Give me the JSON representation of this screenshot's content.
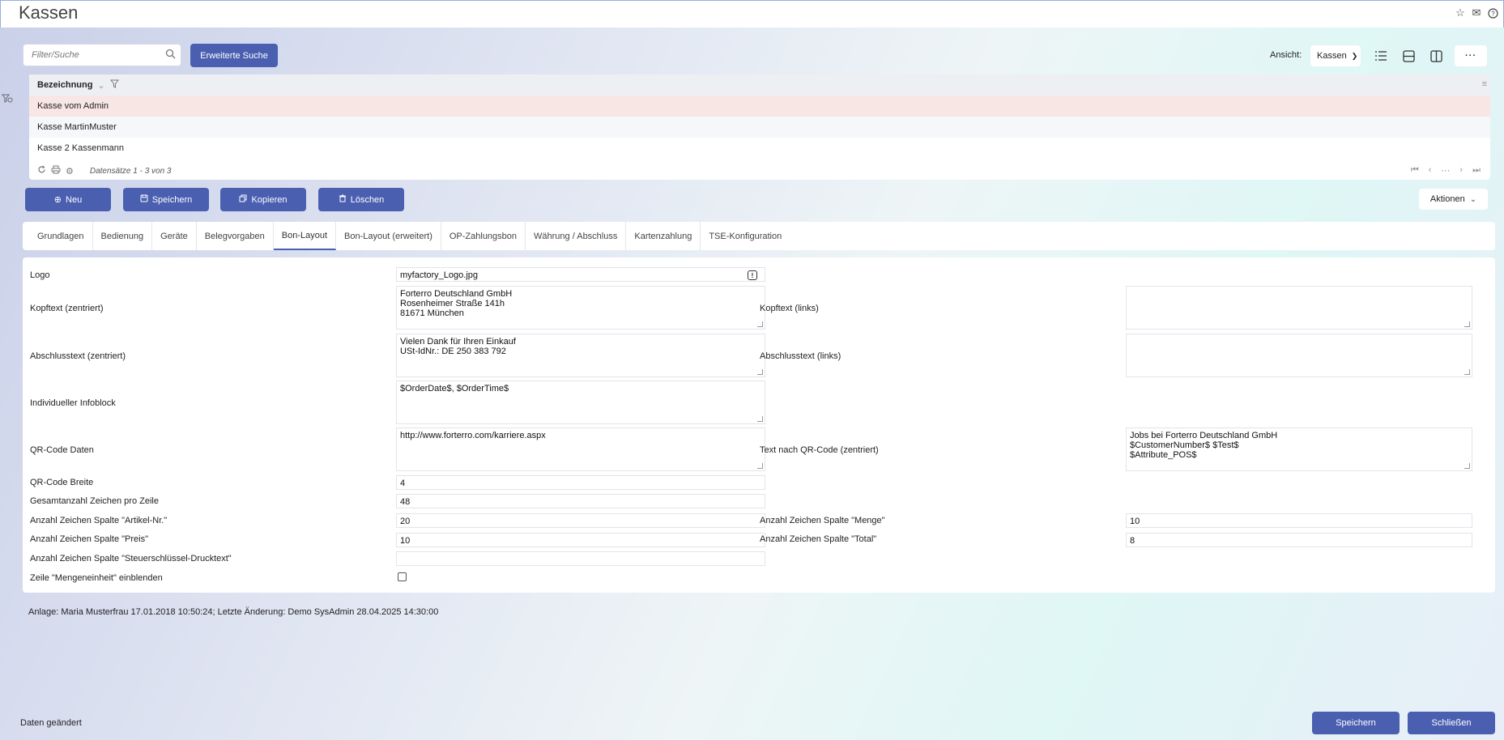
{
  "window": {
    "title": "Kassen"
  },
  "toolbar": {
    "search_placeholder": "Filter/Suche",
    "extended_search": "Erweiterte Suche",
    "view_label": "Ansicht:",
    "view_value": "Kassen",
    "more": "···"
  },
  "grid": {
    "column": "Bezeichnung",
    "rows": [
      "Kasse vom Admin",
      "Kasse MartinMuster",
      "Kasse 2 Kassenmann"
    ],
    "records": "Datensätze 1 - 3 von 3"
  },
  "actions": {
    "new": "Neu",
    "save": "Speichern",
    "copy": "Kopieren",
    "delete": "Löschen",
    "more_actions": "Aktionen"
  },
  "tabs": [
    "Grundlagen",
    "Bedienung",
    "Geräte",
    "Belegvorgaben",
    "Bon-Layout",
    "Bon-Layout (erweitert)",
    "OP-Zahlungsbon",
    "Währung / Abschluss",
    "Kartenzahlung",
    "TSE-Konfiguration"
  ],
  "active_tab": "Bon-Layout",
  "form": {
    "logo": {
      "label": "Logo",
      "value": "myfactory_Logo.jpg"
    },
    "header_centered": {
      "label": "Kopftext (zentriert)",
      "value": "Forterro Deutschland GmbH\nRosenheimer Straße 141h\n81671 München"
    },
    "header_left": {
      "label": "Kopftext (links)",
      "value": ""
    },
    "footer_centered": {
      "label": "Abschlusstext (zentriert)",
      "value": "Vielen Dank für Ihren Einkauf\nUSt-IdNr.: DE 250 383 792"
    },
    "footer_left": {
      "label": "Abschlusstext (links)",
      "value": ""
    },
    "info_block": {
      "label": "Individueller Infoblock",
      "value": "$OrderDate$, $OrderTime$"
    },
    "qr_data": {
      "label": "QR-Code Daten",
      "value": "http://www.forterro.com/karriere.aspx"
    },
    "qr_text": {
      "label": "Text nach QR-Code (zentriert)",
      "value": "Jobs bei Forterro Deutschland GmbH\n$CustomerNumber$ $Test$\n$Attribute_POS$"
    },
    "qr_width": {
      "label": "QR-Code Breite",
      "value": "4"
    },
    "chars_per_line": {
      "label": "Gesamtanzahl Zeichen pro Zeile",
      "value": "48"
    },
    "col_article": {
      "label": "Anzahl Zeichen Spalte \"Artikel-Nr.\"",
      "value": "20"
    },
    "col_quantity": {
      "label": "Anzahl Zeichen Spalte \"Menge\"",
      "value": "10"
    },
    "col_price": {
      "label": "Anzahl Zeichen Spalte \"Preis\"",
      "value": "10"
    },
    "col_total": {
      "label": "Anzahl Zeichen Spalte \"Total\"",
      "value": "8"
    },
    "col_tax": {
      "label": "Anzahl Zeichen Spalte \"Steuerschlüssel-Drucktext\"",
      "value": ""
    },
    "show_unit": {
      "label": "Zeile \"Mengeneinheit\" einblenden",
      "checked": false
    }
  },
  "audit": "Anlage: Maria Musterfrau 17.01.2018 10:50:24; Letzte Änderung: Demo SysAdmin 28.04.2025 14:30:00",
  "status": "Daten geändert",
  "footer": {
    "save": "Speichern",
    "close": "Schließen"
  },
  "colors": {
    "primary": "#4a5fb0",
    "selected_row": "#f8e6e4"
  }
}
